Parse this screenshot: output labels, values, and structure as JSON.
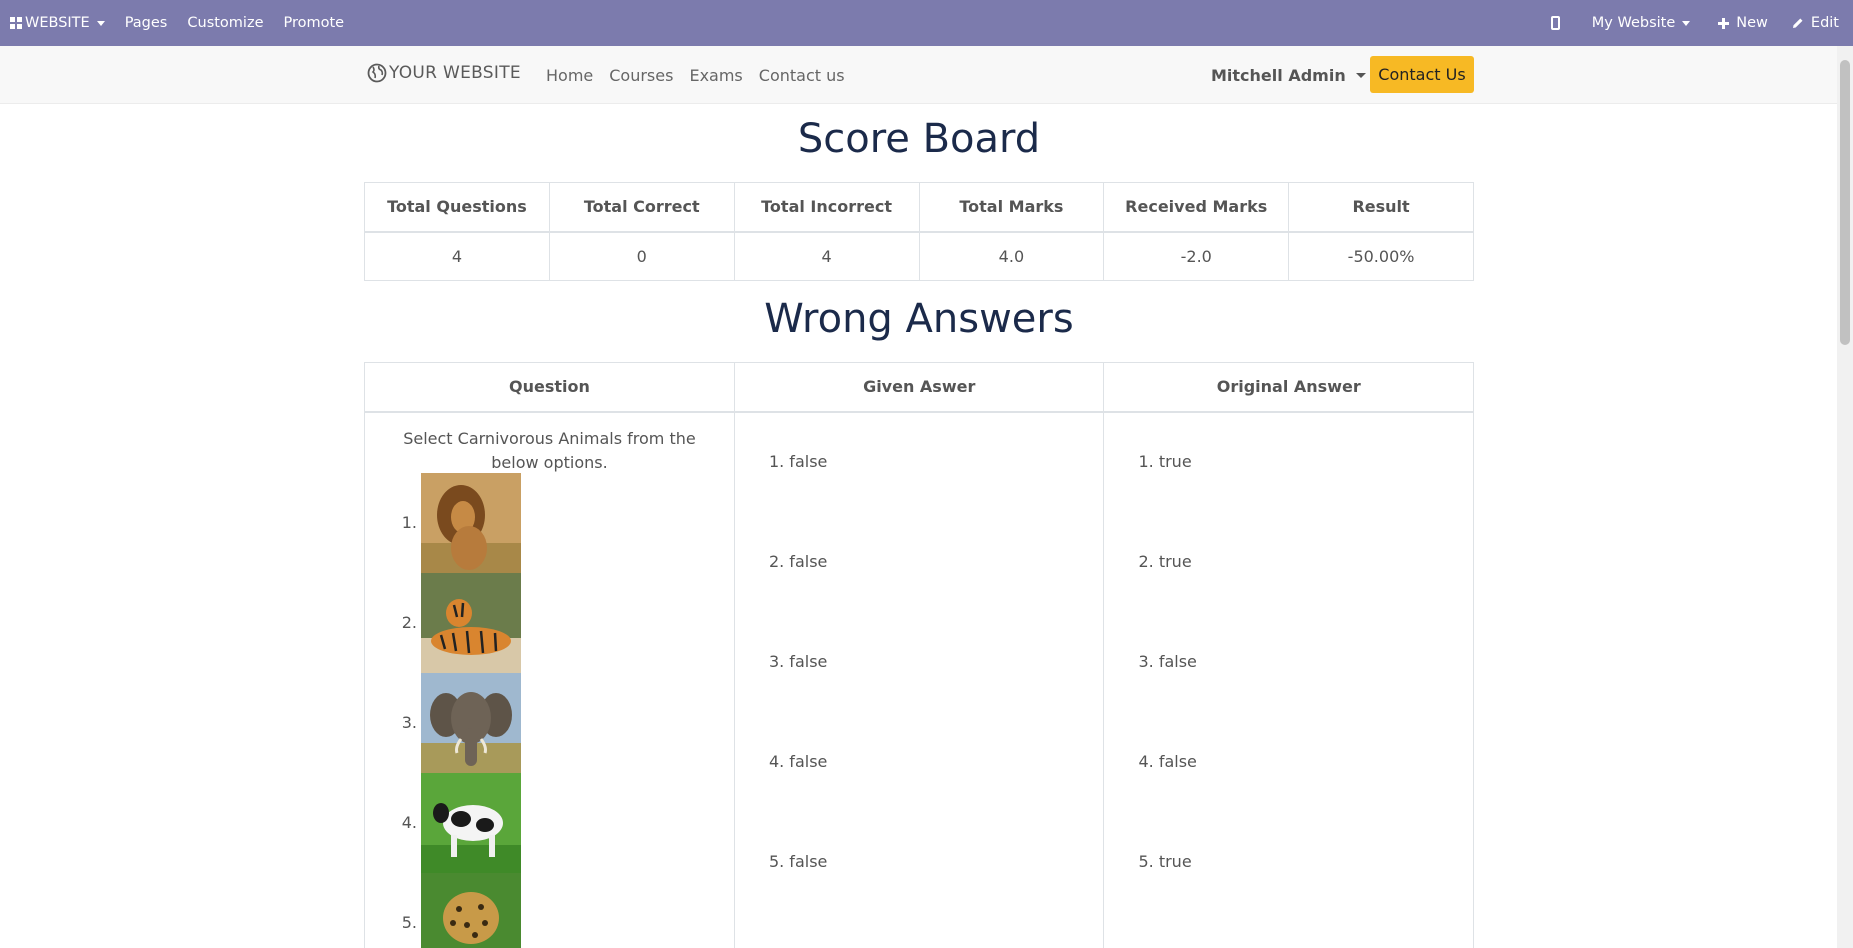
{
  "adminbar": {
    "website_label": "WEBSITE",
    "pages": "Pages",
    "customize": "Customize",
    "promote": "Promote",
    "site_selector": "My Website",
    "new": "New",
    "edit": "Edit"
  },
  "header": {
    "logo": "YOUR WEBSITE",
    "nav": [
      "Home",
      "Courses",
      "Exams",
      "Contact us"
    ],
    "user": "Mitchell Admin",
    "contact_button": "Contact Us"
  },
  "scoreboard": {
    "title": "Score Board",
    "headers": [
      "Total Questions",
      "Total Correct",
      "Total Incorrect",
      "Total Marks",
      "Received Marks",
      "Result"
    ],
    "values": [
      "4",
      "0",
      "4",
      "4.0",
      "-2.0",
      "-50.00%"
    ]
  },
  "wrong": {
    "title": "Wrong Answers",
    "headers": [
      "Question",
      "Given Aswer",
      "Original Answer"
    ],
    "question": "Select Carnivorous Animals from the below options.",
    "options": [
      {
        "num": "1.",
        "icon": "lion-image"
      },
      {
        "num": "2.",
        "icon": "tiger-image"
      },
      {
        "num": "3.",
        "icon": "elephant-image"
      },
      {
        "num": "4.",
        "icon": "cow-image"
      },
      {
        "num": "5.",
        "icon": "leopard-image"
      }
    ],
    "given": [
      "1. false",
      "2. false",
      "3. false",
      "4. false",
      "5. false"
    ],
    "original": [
      "1. true",
      "2. true",
      "3. false",
      "4. false",
      "5. true"
    ]
  },
  "colors": {
    "adminbar": "#7c7bad",
    "accent_button": "#f7b924",
    "heading": "#1b2a4a"
  }
}
